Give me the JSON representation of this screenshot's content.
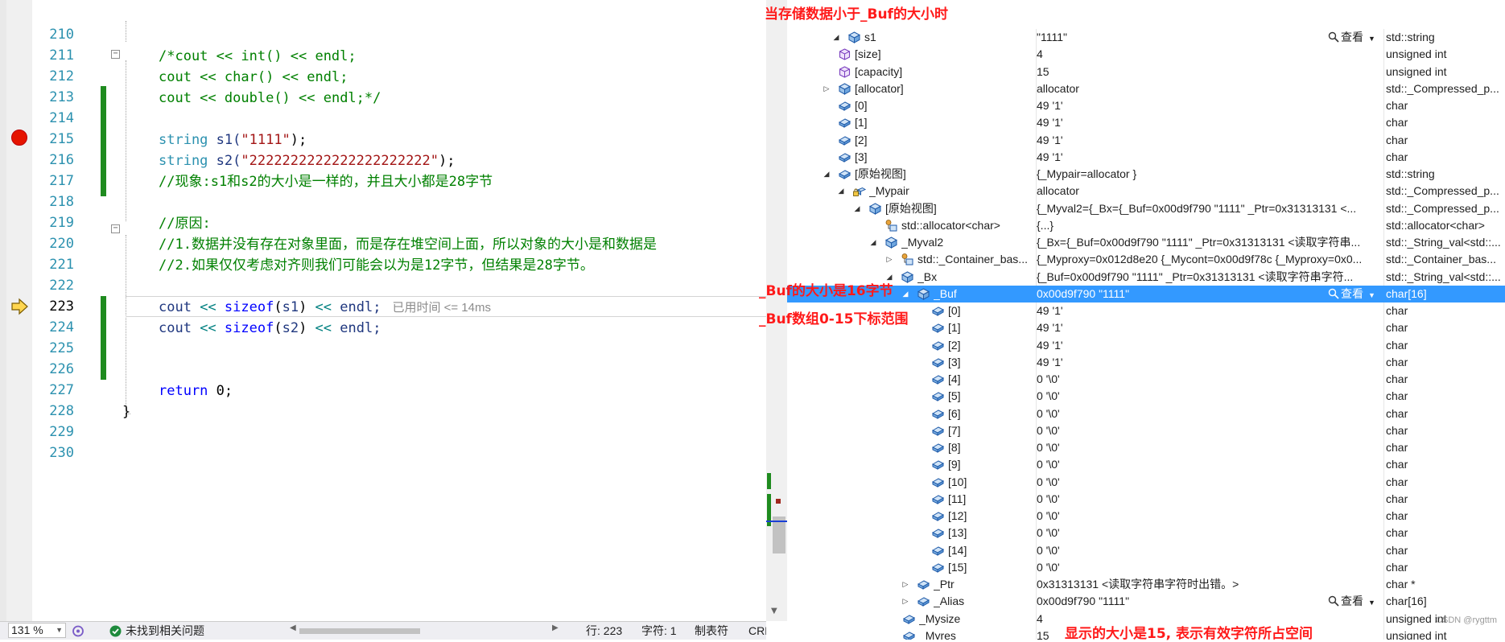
{
  "editor": {
    "line_numbers": [
      "210",
      "211",
      "212",
      "213",
      "214",
      "215",
      "216",
      "217",
      "218",
      "219",
      "220",
      "221",
      "222",
      "223",
      "224",
      "225",
      "226",
      "227",
      "228",
      "229",
      "230"
    ],
    "lines": {
      "l211": "/*cout << int() << endl;",
      "l212_a": "cout << ",
      "l212_b": "char",
      "l212_c": "() << endl;",
      "l213_a": "cout << ",
      "l213_b": "double",
      "l213_c": "() << endl;*/",
      "l215_type": "string",
      "l215_var": " s1(",
      "l215_str": "\"1111\"",
      "l215_end": ");",
      "l216_type": "string",
      "l216_var": " s2(",
      "l216_str": "\"2222222222222222222222\"",
      "l216_end": ");",
      "l217": "//现象:s1和s2的大小是一样的，并且大小都是28字节",
      "l219": "//原因:",
      "l220": "//1.数据并没有存在对象里面，而是存在堆空间上面，所以对象的大小是和数据是",
      "l221": "//2.如果仅仅考虑对齐则我们可能会以为是12字节，但结果是28字节。",
      "l223_a": "cout ",
      "l223_op1": "<<",
      "l223_fn": " sizeof",
      "l223_b": "(",
      "l223_v": "s1",
      "l223_c": ") ",
      "l223_op2": "<<",
      "l223_d": " endl;",
      "l223_elapsed": "已用时间 <= 14ms",
      "l224_a": "cout ",
      "l224_op1": "<<",
      "l224_fn": " sizeof",
      "l224_b": "(",
      "l224_v": "s2",
      "l224_c": ") ",
      "l224_op2": "<<",
      "l224_d": " endl;",
      "l227_kw": "return",
      "l227_rest": " 0;",
      "l228": "}"
    }
  },
  "status_bar": {
    "zoom": "131 %",
    "issues": "未找到相关问题",
    "line": "行: 223",
    "char": "字符: 1",
    "tab": "制表符",
    "eol": "CRLF"
  },
  "watch": {
    "view_label": "查看",
    "rows": [
      {
        "name": "s1",
        "value": "\"1111\"",
        "type": "std::string"
      },
      {
        "name": "[size]",
        "value": "4",
        "type": "unsigned int"
      },
      {
        "name": "[capacity]",
        "value": "15",
        "type": "unsigned int"
      },
      {
        "name": "[allocator]",
        "value": "allocator",
        "type": "std::_Compressed_p..."
      },
      {
        "name": "[0]",
        "value": "49 '1'",
        "type": "char"
      },
      {
        "name": "[1]",
        "value": "49 '1'",
        "type": "char"
      },
      {
        "name": "[2]",
        "value": "49 '1'",
        "type": "char"
      },
      {
        "name": "[3]",
        "value": "49 '1'",
        "type": "char"
      },
      {
        "name": "[原始视图]",
        "value": "{_Mypair=allocator }",
        "type": "std::string"
      },
      {
        "name": "_Mypair",
        "value": "allocator",
        "type": "std::_Compressed_p..."
      },
      {
        "name": "[原始视图]",
        "value": "{_Myval2={_Bx={_Buf=0x00d9f790 \"1111\" _Ptr=0x31313131 <...",
        "type": "std::_Compressed_p..."
      },
      {
        "name": "std::allocator<char>",
        "value": "{...}",
        "type": "std::allocator<char>"
      },
      {
        "name": "_Myval2",
        "value": "{_Bx={_Buf=0x00d9f790 \"1111\" _Ptr=0x31313131 <读取字符串...",
        "type": "std::_String_val<std::..."
      },
      {
        "name": "std::_Container_bas...",
        "value": "{_Myproxy=0x012d8e20 {_Mycont=0x00d9f78c {_Myproxy=0x0...",
        "type": "std::_Container_bas..."
      },
      {
        "name": "_Bx",
        "value": "{_Buf=0x00d9f790 \"1111\" _Ptr=0x31313131 <读取字符串字符...",
        "type": "std::_String_val<std::..."
      },
      {
        "name": "_Buf",
        "value": "0x00d9f790 \"1111\"",
        "type": "char[16]"
      },
      {
        "name": "[0]",
        "value": "49 '1'",
        "type": "char"
      },
      {
        "name": "[1]",
        "value": "49 '1'",
        "type": "char"
      },
      {
        "name": "[2]",
        "value": "49 '1'",
        "type": "char"
      },
      {
        "name": "[3]",
        "value": "49 '1'",
        "type": "char"
      },
      {
        "name": "[4]",
        "value": "0 '\\0'",
        "type": "char"
      },
      {
        "name": "[5]",
        "value": "0 '\\0'",
        "type": "char"
      },
      {
        "name": "[6]",
        "value": "0 '\\0'",
        "type": "char"
      },
      {
        "name": "[7]",
        "value": "0 '\\0'",
        "type": "char"
      },
      {
        "name": "[8]",
        "value": "0 '\\0'",
        "type": "char"
      },
      {
        "name": "[9]",
        "value": "0 '\\0'",
        "type": "char"
      },
      {
        "name": "[10]",
        "value": "0 '\\0'",
        "type": "char"
      },
      {
        "name": "[11]",
        "value": "0 '\\0'",
        "type": "char"
      },
      {
        "name": "[12]",
        "value": "0 '\\0'",
        "type": "char"
      },
      {
        "name": "[13]",
        "value": "0 '\\0'",
        "type": "char"
      },
      {
        "name": "[14]",
        "value": "0 '\\0'",
        "type": "char"
      },
      {
        "name": "[15]",
        "value": "0 '\\0'",
        "type": "char"
      },
      {
        "name": "_Ptr",
        "value": "0x31313131 <读取字符串字符时出错。>",
        "type": "char *"
      },
      {
        "name": "_Alias",
        "value": "0x00d9f790 \"1111\"",
        "type": "char[16]"
      },
      {
        "name": "_Mysize",
        "value": "4",
        "type": "unsigned int"
      },
      {
        "name": "_Myres",
        "value": "15",
        "type": "unsigned int"
      }
    ]
  },
  "annotations": {
    "top": "当存储数据小于_Buf的大小时",
    "buf_size": "_Buf的大小是16字节",
    "buf_range": "_Buf数组0-15下标范围",
    "myres": "显示的大小是15, 表示有效字符所占空间"
  },
  "watermark": "CSDN @rygttm",
  "colors": {
    "selection": "#3399ff",
    "annotation": "#ff1a1a",
    "change_bar": "#1f8b1f",
    "breakpoint": "#e51400"
  }
}
